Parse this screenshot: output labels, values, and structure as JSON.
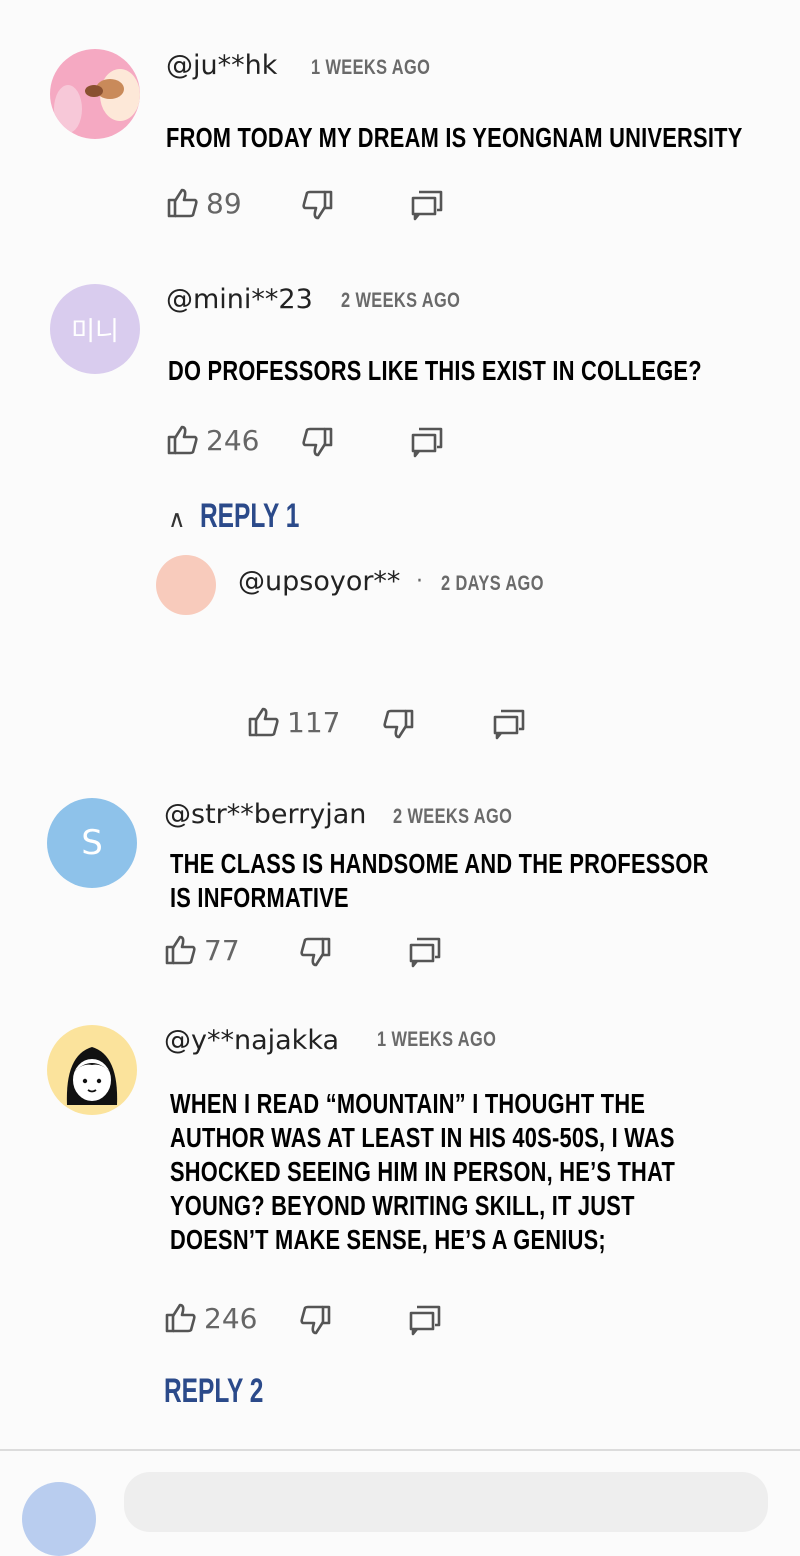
{
  "comments": [
    {
      "username": "@ju**hk",
      "time": "1 WEEKS AGO",
      "text_lines": [
        "FROM TODAY MY DREAM IS YEONGNAM UNIVERSITY"
      ],
      "likes": "89"
    },
    {
      "username": "@mini**23",
      "time": "2 WEEKS AGO",
      "avatar_text": "미니",
      "text_lines": [
        "DO PROFESSORS LIKE THIS EXIST IN COLLEGE?"
      ],
      "likes": "246",
      "reply_toggle": "REPLY 1",
      "reply_caret": "∧",
      "replies": [
        {
          "username": "@upsoyor**",
          "separator": "·",
          "time": "2 DAYS AGO",
          "likes": "117"
        }
      ]
    },
    {
      "username": "@str**berryjan",
      "time": "2 WEEKS AGO",
      "avatar_text": "S",
      "text_lines": [
        "THE CLASS IS HANDSOME AND THE PROFESSOR",
        "IS INFORMATIVE"
      ],
      "likes": "77"
    },
    {
      "username": "@y**najakka",
      "time": "1 WEEKS AGO",
      "text_lines": [
        "WHEN I READ “MOUNTAIN” I THOUGHT THE",
        "AUTHOR WAS AT LEAST IN HIS 40S-50S, I WAS",
        "SHOCKED SEEING HIM IN PERSON, HE’S THAT",
        "YOUNG? BEYOND WRITING SKILL, IT JUST",
        "DOESN’T MAKE SENSE, HE’S A GENIUS;"
      ],
      "likes": "246",
      "reply_toggle": "REPLY 2"
    }
  ],
  "colors": {
    "reply_link": "#2b4a8a",
    "avatar_mini": "#d9ccee",
    "avatar_s": "#8ec2ea",
    "avatar_upsoyor": "#f8cbbc",
    "avatar_yna": "#fbe39c"
  },
  "icons": [
    "like-icon",
    "dislike-icon",
    "reply-comment-icon"
  ]
}
